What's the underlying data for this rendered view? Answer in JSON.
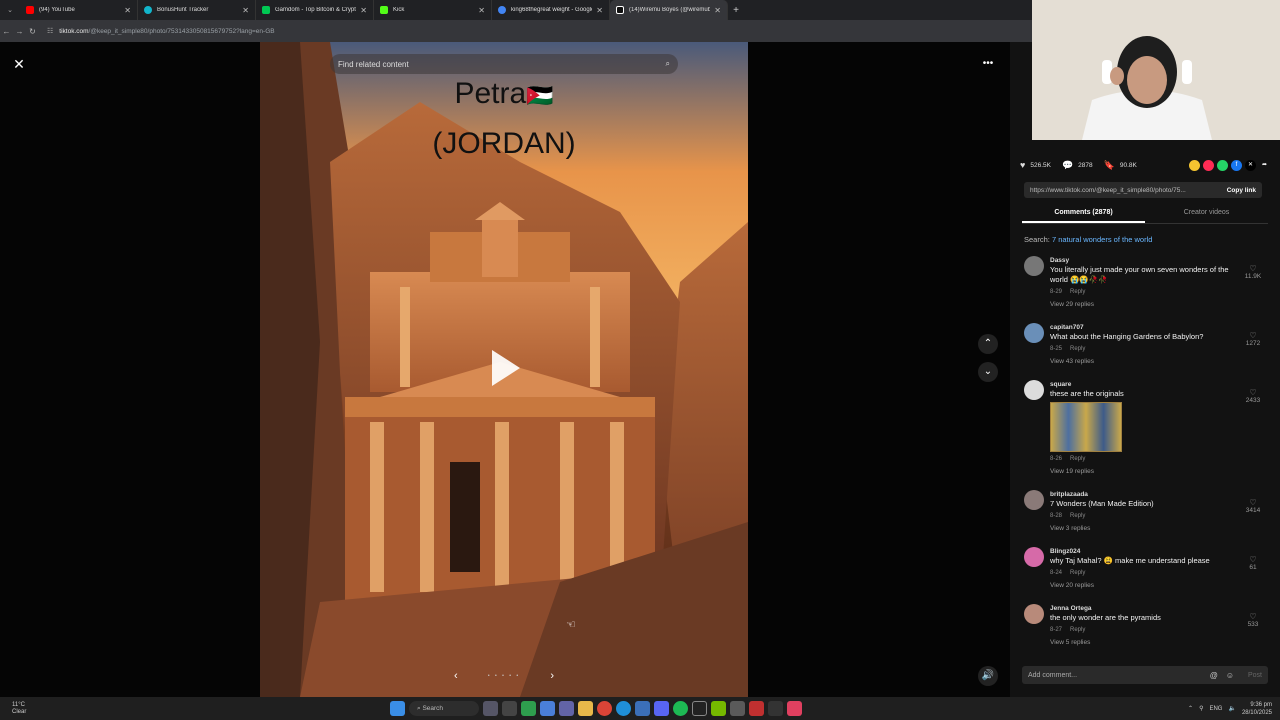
{
  "browser": {
    "tabs": [
      {
        "title": "(94) YouTube",
        "color": "#ff0000",
        "active": false
      },
      {
        "title": "BonusHunt Tracker",
        "color": "#12b5cb",
        "active": false
      },
      {
        "title": "Gamdom - Top Bitcoin & Crypto",
        "color": "#00c853",
        "active": false
      },
      {
        "title": "Kick",
        "color": "#53fc18",
        "active": false
      },
      {
        "title": "king68thegreat weight - Google",
        "color": "#4285f4",
        "active": false
      },
      {
        "title": "(14)Wiremu Boyes (@wiremub...",
        "color": "#ffffff",
        "active": true
      }
    ],
    "url_host": "tiktok.com",
    "url_path": "/@keep_it_simple80/photo/7531433050815679752?lang=en-GB"
  },
  "viewer": {
    "search_placeholder": "Find related content",
    "image_title_line1": "Petra",
    "image_title_flag": "🇯🇴",
    "image_title_line2": "(JORDAN)",
    "slide_dots": "• • • • •"
  },
  "actions": {
    "likes": "526.5K",
    "comments": "2878",
    "saves": "90.8K",
    "share_icons": [
      "#f4c430",
      "#fe2c55",
      "#25d366",
      "#1877f2",
      "#000000",
      "#333333"
    ]
  },
  "link": {
    "url": "https://www.tiktok.com/@keep_it_simple80/photo/75...",
    "copy_label": "Copy link"
  },
  "tabs": {
    "comments_label": "Comments (2878)",
    "creator_label": "Creator videos"
  },
  "related_search": {
    "prefix": "Search:",
    "query": "7 natural wonders of the world"
  },
  "comments": [
    {
      "name": "Dassy",
      "text": "You literally just made your own seven wonders of the world 😭😭🥀🥀",
      "date": "8-29",
      "reply": "Reply",
      "replies": "View 29 replies",
      "likes": "11.9K",
      "avatar": "#777777"
    },
    {
      "name": "capitan707",
      "text": "What about the Hanging Gardens of Babylon?",
      "date": "8-25",
      "reply": "Reply",
      "replies": "View 43 replies",
      "likes": "1272",
      "avatar": "#6a8fb8"
    },
    {
      "name": "square",
      "text": "these are the originals",
      "date": "8-26",
      "reply": "Reply",
      "replies": "View 19 replies",
      "likes": "2433",
      "avatar": "#dcdcdc"
    },
    {
      "name": "britplazaada",
      "text": "7 Wonders (Man Made Edition)",
      "date": "8-28",
      "reply": "Reply",
      "replies": "View 3 replies",
      "likes": "3414",
      "avatar": "#8a7a78"
    },
    {
      "name": "Blingz024",
      "text": "why Taj Mahal? 😩 make me understand please",
      "date": "8-24",
      "reply": "Reply",
      "replies": "View 20 replies",
      "likes": "61",
      "avatar": "#d66aa8"
    },
    {
      "name": "Jenna Ortega",
      "text": "the only wonder are the pyramids",
      "date": "8-27",
      "reply": "Reply",
      "replies": "View 5 replies",
      "likes": "533",
      "avatar": "#b88a7a"
    }
  ],
  "add_comment": {
    "placeholder": "Add comment...",
    "post_label": "Post"
  },
  "taskbar": {
    "weather_temp": "11°C",
    "weather_desc": "Clear",
    "search_label": "Search",
    "lang": "ENG",
    "time": "9:36 pm",
    "date": "28/10/2025"
  }
}
